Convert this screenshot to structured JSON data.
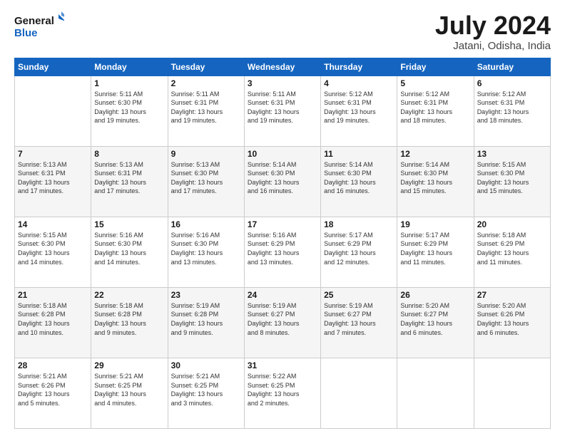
{
  "header": {
    "logo_line1": "General",
    "logo_line2": "Blue",
    "month": "July 2024",
    "location": "Jatani, Odisha, India"
  },
  "weekdays": [
    "Sunday",
    "Monday",
    "Tuesday",
    "Wednesday",
    "Thursday",
    "Friday",
    "Saturday"
  ],
  "weeks": [
    [
      {
        "day": "",
        "info": ""
      },
      {
        "day": "1",
        "info": "Sunrise: 5:11 AM\nSunset: 6:30 PM\nDaylight: 13 hours\nand 19 minutes."
      },
      {
        "day": "2",
        "info": "Sunrise: 5:11 AM\nSunset: 6:31 PM\nDaylight: 13 hours\nand 19 minutes."
      },
      {
        "day": "3",
        "info": "Sunrise: 5:11 AM\nSunset: 6:31 PM\nDaylight: 13 hours\nand 19 minutes."
      },
      {
        "day": "4",
        "info": "Sunrise: 5:12 AM\nSunset: 6:31 PM\nDaylight: 13 hours\nand 19 minutes."
      },
      {
        "day": "5",
        "info": "Sunrise: 5:12 AM\nSunset: 6:31 PM\nDaylight: 13 hours\nand 18 minutes."
      },
      {
        "day": "6",
        "info": "Sunrise: 5:12 AM\nSunset: 6:31 PM\nDaylight: 13 hours\nand 18 minutes."
      }
    ],
    [
      {
        "day": "7",
        "info": "Sunrise: 5:13 AM\nSunset: 6:31 PM\nDaylight: 13 hours\nand 17 minutes."
      },
      {
        "day": "8",
        "info": "Sunrise: 5:13 AM\nSunset: 6:31 PM\nDaylight: 13 hours\nand 17 minutes."
      },
      {
        "day": "9",
        "info": "Sunrise: 5:13 AM\nSunset: 6:30 PM\nDaylight: 13 hours\nand 17 minutes."
      },
      {
        "day": "10",
        "info": "Sunrise: 5:14 AM\nSunset: 6:30 PM\nDaylight: 13 hours\nand 16 minutes."
      },
      {
        "day": "11",
        "info": "Sunrise: 5:14 AM\nSunset: 6:30 PM\nDaylight: 13 hours\nand 16 minutes."
      },
      {
        "day": "12",
        "info": "Sunrise: 5:14 AM\nSunset: 6:30 PM\nDaylight: 13 hours\nand 15 minutes."
      },
      {
        "day": "13",
        "info": "Sunrise: 5:15 AM\nSunset: 6:30 PM\nDaylight: 13 hours\nand 15 minutes."
      }
    ],
    [
      {
        "day": "14",
        "info": "Sunrise: 5:15 AM\nSunset: 6:30 PM\nDaylight: 13 hours\nand 14 minutes."
      },
      {
        "day": "15",
        "info": "Sunrise: 5:16 AM\nSunset: 6:30 PM\nDaylight: 13 hours\nand 14 minutes."
      },
      {
        "day": "16",
        "info": "Sunrise: 5:16 AM\nSunset: 6:30 PM\nDaylight: 13 hours\nand 13 minutes."
      },
      {
        "day": "17",
        "info": "Sunrise: 5:16 AM\nSunset: 6:29 PM\nDaylight: 13 hours\nand 13 minutes."
      },
      {
        "day": "18",
        "info": "Sunrise: 5:17 AM\nSunset: 6:29 PM\nDaylight: 13 hours\nand 12 minutes."
      },
      {
        "day": "19",
        "info": "Sunrise: 5:17 AM\nSunset: 6:29 PM\nDaylight: 13 hours\nand 11 minutes."
      },
      {
        "day": "20",
        "info": "Sunrise: 5:18 AM\nSunset: 6:29 PM\nDaylight: 13 hours\nand 11 minutes."
      }
    ],
    [
      {
        "day": "21",
        "info": "Sunrise: 5:18 AM\nSunset: 6:28 PM\nDaylight: 13 hours\nand 10 minutes."
      },
      {
        "day": "22",
        "info": "Sunrise: 5:18 AM\nSunset: 6:28 PM\nDaylight: 13 hours\nand 9 minutes."
      },
      {
        "day": "23",
        "info": "Sunrise: 5:19 AM\nSunset: 6:28 PM\nDaylight: 13 hours\nand 9 minutes."
      },
      {
        "day": "24",
        "info": "Sunrise: 5:19 AM\nSunset: 6:27 PM\nDaylight: 13 hours\nand 8 minutes."
      },
      {
        "day": "25",
        "info": "Sunrise: 5:19 AM\nSunset: 6:27 PM\nDaylight: 13 hours\nand 7 minutes."
      },
      {
        "day": "26",
        "info": "Sunrise: 5:20 AM\nSunset: 6:27 PM\nDaylight: 13 hours\nand 6 minutes."
      },
      {
        "day": "27",
        "info": "Sunrise: 5:20 AM\nSunset: 6:26 PM\nDaylight: 13 hours\nand 6 minutes."
      }
    ],
    [
      {
        "day": "28",
        "info": "Sunrise: 5:21 AM\nSunset: 6:26 PM\nDaylight: 13 hours\nand 5 minutes."
      },
      {
        "day": "29",
        "info": "Sunrise: 5:21 AM\nSunset: 6:25 PM\nDaylight: 13 hours\nand 4 minutes."
      },
      {
        "day": "30",
        "info": "Sunrise: 5:21 AM\nSunset: 6:25 PM\nDaylight: 13 hours\nand 3 minutes."
      },
      {
        "day": "31",
        "info": "Sunrise: 5:22 AM\nSunset: 6:25 PM\nDaylight: 13 hours\nand 2 minutes."
      },
      {
        "day": "",
        "info": ""
      },
      {
        "day": "",
        "info": ""
      },
      {
        "day": "",
        "info": ""
      }
    ]
  ]
}
